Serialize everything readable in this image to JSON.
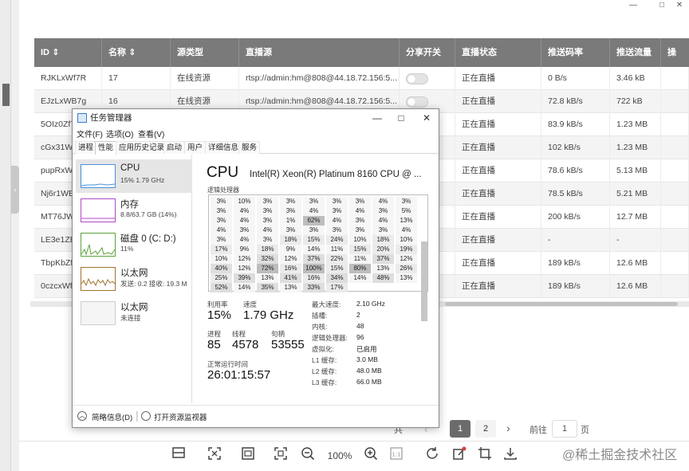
{
  "window_controls": {
    "minimize": "—",
    "maximize": "□",
    "close": "✕"
  },
  "table": {
    "columns": [
      "ID",
      "名称",
      "源类型",
      "直播源",
      "分享开关",
      "直播状态",
      "推送码率",
      "推送流量",
      "操"
    ],
    "sort_mark": "⇕",
    "rows": [
      {
        "id": "RJKLxWf7R",
        "name": "17",
        "source_type": "在线资源",
        "source": "rtsp://admin:hm@808@44.18.72.156:5...",
        "status": "正在直播",
        "bitrate": "0 B/s",
        "traffic": "3.46 kB"
      },
      {
        "id": "EJzLxWB7g",
        "name": "16",
        "source_type": "在线资源",
        "source": "rtsp://admin:hm@808@44.18.72.156:5...",
        "status": "正在直播",
        "bitrate": "72.8 kB/s",
        "traffic": "722 kB"
      },
      {
        "id": "5OIz0Zf7",
        "name": "",
        "source_type": "",
        "source": "",
        "status": "正在直播",
        "bitrate": "83.9 kB/s",
        "traffic": "1.23 MB"
      },
      {
        "id": "cGx31W",
        "name": "",
        "source_type": "",
        "source": "",
        "status": "正在直播",
        "bitrate": "102 kB/s",
        "traffic": "1.23 MB"
      },
      {
        "id": "pupRxW",
        "name": "",
        "source_type": "",
        "source": "",
        "status": "正在直播",
        "bitrate": "78.6 kB/s",
        "traffic": "5.13 MB"
      },
      {
        "id": "Nj6r1WB",
        "name": "",
        "source_type": "",
        "source": "",
        "status": "正在直播",
        "bitrate": "78.5 kB/s",
        "traffic": "5.21 MB"
      },
      {
        "id": "MT76JW",
        "name": "",
        "source_type": "",
        "source": "",
        "status": "正在直播",
        "bitrate": "200 kB/s",
        "traffic": "12.7 MB"
      },
      {
        "id": "LE3e1ZE",
        "name": "",
        "source_type": "",
        "source": "",
        "status": "正在直播",
        "bitrate": "-",
        "traffic": "-"
      },
      {
        "id": "TbpKbZf",
        "name": "",
        "source_type": "",
        "source": "",
        "status": "正在直播",
        "bitrate": "189 kB/s",
        "traffic": "12.6 MB"
      },
      {
        "id": "0czcxWf",
        "name": "",
        "source_type": "",
        "source": "",
        "status": "正在直播",
        "bitrate": "189 kB/s",
        "traffic": "12.6 MB"
      }
    ]
  },
  "pagination": {
    "total_text": "共",
    "pages": [
      "1",
      "2"
    ],
    "current": "1",
    "next": "›",
    "goto_label": "前往",
    "goto_value": "1",
    "page_suffix": "页"
  },
  "toolbar": {
    "zoom": "100%",
    "watermark": "@稀土掘金技术社区"
  },
  "taskmanager": {
    "title": "任务管理器",
    "menu": [
      "文件(F)",
      "选项(O)",
      "查看(V)"
    ],
    "tabs": [
      "进程",
      "性能",
      "应用历史记录",
      "启动",
      "用户",
      "详细信息",
      "服务"
    ],
    "selected_tab": "性能",
    "side": [
      {
        "name": "CPU",
        "sub": "15% 1.79 GHz"
      },
      {
        "name": "内存",
        "sub": "8.8/63.7 GB (14%)"
      },
      {
        "name": "磁盘 0 (C: D:)",
        "sub": "11%"
      },
      {
        "name": "以太网",
        "sub": "发送: 0.2 接收: 19.3 M"
      },
      {
        "name": "以太网",
        "sub": "未连接"
      }
    ],
    "cpu": {
      "title": "CPU",
      "name": "Intel(R) Xeon(R) Platinum 8160 CPU @ ...",
      "lp_label": "逻辑处理器",
      "grid": [
        [
          "3%",
          "10%",
          "3%",
          "3%",
          "3%",
          "3%",
          "3%",
          "4%",
          "3%"
        ],
        [
          "3%",
          "4%",
          "3%",
          "3%",
          "4%",
          "3%",
          "4%",
          "3%",
          "5%"
        ],
        [
          "3%",
          "4%",
          "3%",
          "1%",
          "62%",
          "4%",
          "3%",
          "4%",
          "13%"
        ],
        [
          "4%",
          "3%",
          "4%",
          "3%",
          "3%",
          "3%",
          "3%",
          "3%",
          "4%"
        ],
        [
          "3%",
          "4%",
          "3%",
          "18%",
          "15%",
          "24%",
          "10%",
          "18%",
          "10%"
        ],
        [
          "17%",
          "9%",
          "18%",
          "9%",
          "14%",
          "11%",
          "15%",
          "20%",
          "19%"
        ],
        [
          "10%",
          "12%",
          "32%",
          "12%",
          "37%",
          "22%",
          "11%",
          "37%",
          "12%"
        ],
        [
          "40%",
          "12%",
          "72%",
          "16%",
          "100%",
          "15%",
          "80%",
          "13%",
          "26%"
        ],
        [
          "25%",
          "39%",
          "13%",
          "41%",
          "16%",
          "34%",
          "14%",
          "48%",
          "13%"
        ],
        [
          "52%",
          "14%",
          "35%",
          "13%",
          "33%",
          "17%",
          "",
          "",
          ""
        ]
      ],
      "util_label": "利用率",
      "util_value": "15%",
      "speed_label": "速度",
      "speed_value": "1.79 GHz",
      "proc_label": "进程",
      "proc_value": "85",
      "thread_label": "线程",
      "thread_value": "4578",
      "handle_label": "句柄",
      "handle_value": "53555",
      "uptime_label": "正常运行时间",
      "uptime_value": "26:01:15:57",
      "right": [
        {
          "label": "最大速度:",
          "value": "2.10 GHz"
        },
        {
          "label": "插槽:",
          "value": "2"
        },
        {
          "label": "内核:",
          "value": "48"
        },
        {
          "label": "逻辑处理器:",
          "value": "96"
        },
        {
          "label": "虚拟化:",
          "value": "已启用"
        },
        {
          "label": "L1 缓存:",
          "value": "3.0 MB"
        },
        {
          "label": "L2 缓存:",
          "value": "48.0 MB"
        },
        {
          "label": "L3 缓存:",
          "value": "66.0 MB"
        }
      ]
    },
    "footer": {
      "brief": "简略信息(D)",
      "monitor": "打开资源监视器"
    }
  }
}
